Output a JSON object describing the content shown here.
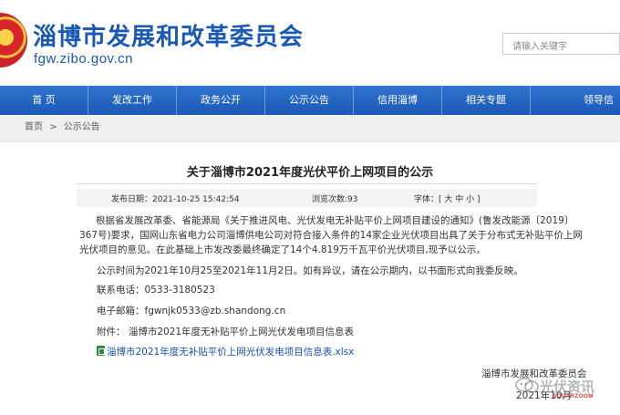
{
  "header": {
    "site_title": "淄博市发展和改革委员会",
    "site_domain": "fgw.zibo.gov.cn",
    "search_placeholder": "请输入关键字"
  },
  "nav": {
    "items": [
      {
        "label": "首 页"
      },
      {
        "label": "发改工作"
      },
      {
        "label": "政务公开"
      },
      {
        "label": "公示公告"
      },
      {
        "label": "信用淄博"
      },
      {
        "label": "相关专题"
      },
      {
        "label": "领导信"
      }
    ]
  },
  "breadcrumb": {
    "home": "首页",
    "separator": ">",
    "current": "公示公告"
  },
  "article": {
    "title": "关于淄博市2021年度光伏平价上网项目的公示",
    "publish_date": "发布日期：2021-10-25 15:42:54",
    "view_count": "浏览次数:93",
    "font_size_label": "字体：[ 大 中 小 ]",
    "paragraph_1": "根据省发展改革委、省能源局《关于推进风电、光伏发电无补贴平价上网项目建设的通知》(鲁发改能源〔2019〕367号)要求，国网山东省电力公司淄博供电公司对符合接入条件的14家企业光伏项目出具了关于分布式无补贴平价上网光伏项目的意见。在此基础上市发改委最终确定了14个4.819万千瓦平价光伏项目,现予以公示。",
    "paragraph_2": "公示时间为2021年10月25至2021年11月2日。如有异议，请在公示期内，以书面形式向我委反映。",
    "phone": "联系电话：0533-3180523",
    "email": "电子邮箱：fgwnjk0533@zb.shandong.cn",
    "attachment": "附件：  淄博市2021年度无补贴平价上网光伏发电项目信息表",
    "attachment_link": "淄博市2021年度无补贴平价上网光伏发电项目信息表.xlsx",
    "signature": "淄博市发展和改革委员会",
    "sign_date": "2021年10月"
  },
  "watermark": {
    "text": "光伏资讯",
    "sub": "SOLARZOOM"
  },
  "colors": {
    "brand_blue": "#1958b4",
    "nav_blue": "#2066c4",
    "link_blue": "#1b4fb0"
  }
}
